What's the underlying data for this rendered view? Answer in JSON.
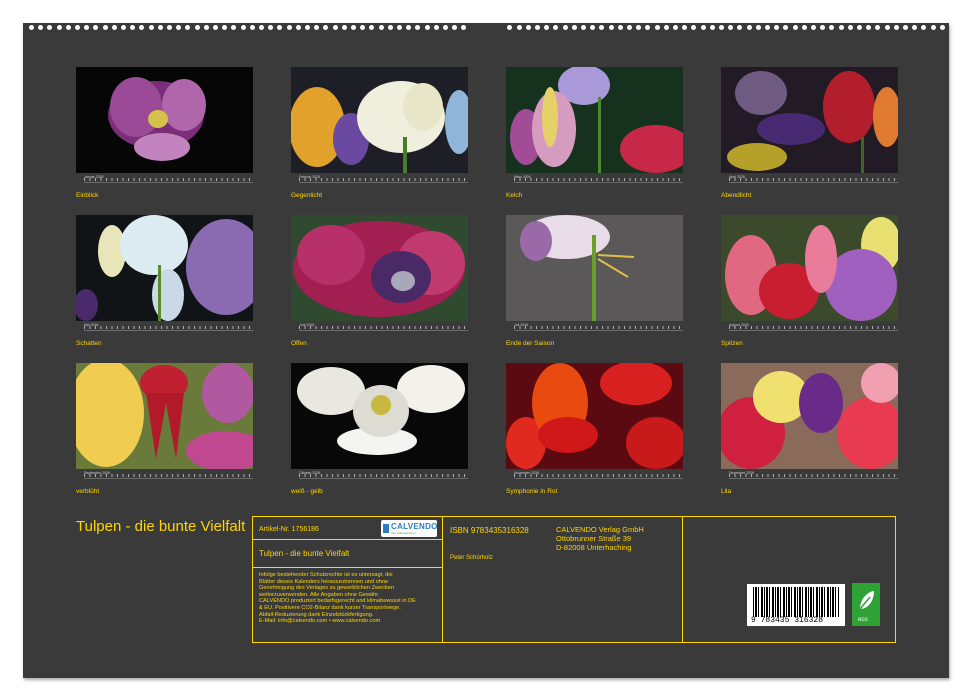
{
  "cover": {
    "title": "Tulpen - die bunte Vielfalt"
  },
  "months": [
    {
      "month": "Januar 2026",
      "title": "Einblick"
    },
    {
      "month": "Februar 2026",
      "title": "Gegenlicht"
    },
    {
      "month": "März 2026",
      "title": "Kelch"
    },
    {
      "month": "April 2026",
      "title": "Abendlicht"
    },
    {
      "month": "Mai 2026",
      "title": "Schatten"
    },
    {
      "month": "Juni 2026",
      "title": "Offen"
    },
    {
      "month": "Juli 2026",
      "title": "Ende der Saison"
    },
    {
      "month": "August 2026",
      "title": "Spitzen"
    },
    {
      "month": "September 2026",
      "title": "verblüht"
    },
    {
      "month": "Oktober 2026",
      "title": "weiß - gelb"
    },
    {
      "month": "November 2026",
      "title": "Symphonie in Rot"
    },
    {
      "month": "Dezember 2026",
      "title": "Lila"
    }
  ],
  "info": {
    "article": "Artikel-Nr. 1756186",
    "logo_text": "CALVENDO",
    "logo_sub": "Ihre Kalenderstory",
    "calendar_title": "Tulpen - die bunte Vielfalt",
    "isbn": "ISBN 9783435316328",
    "publisher_name": "CALVENDO Verlag GmbH",
    "publisher_street": "Ottobrunner Straße 39",
    "publisher_city": "D-82008 Unterhaching",
    "author": "Peter Schürholz",
    "legal": [
      "Infolge bestehender Schutzrechte ist es untersagt, die",
      "Blätter dieses Kalenders herauszutrennen und ohne",
      "Genehmigung des Verlages zu gewerblichen Zwecken",
      "weiterzuverwenden. Alle Angaben ohne Gewähr.",
      "CALVENDO produziert bedarfsgerecht und klimabewusst in DE",
      "& EU. Positivere CO2-Bilanz dank kurzer Transportwege.",
      "Abfall-Reduzierung dank Einzelstückfertigung.",
      "E-Mail: info@calvendo.com • www.calvendo.com"
    ],
    "barcode_number": "9 783435 316328",
    "eco_label": "eco"
  }
}
